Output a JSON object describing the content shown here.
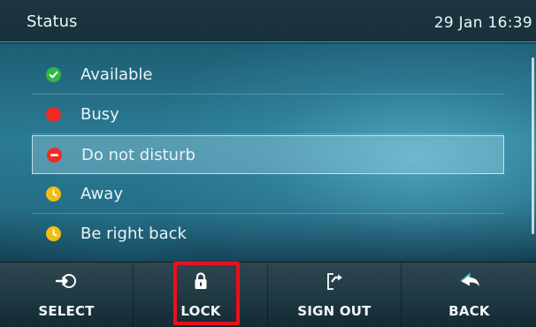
{
  "header": {
    "title": "Status",
    "clock": "29 Jan 16:39"
  },
  "statuses": [
    {
      "label": "Available",
      "icon": "check-circle-icon",
      "color": "#2fb845",
      "selected": false
    },
    {
      "label": "Busy",
      "icon": "red-circle-icon",
      "color": "#ee2b24",
      "selected": false
    },
    {
      "label": "Do not disturb",
      "icon": "minus-circle-icon",
      "color": "#ee2b24",
      "selected": true
    },
    {
      "label": "Away",
      "icon": "clock-circle-icon",
      "color": "#f2bd15",
      "selected": false
    },
    {
      "label": "Be right back",
      "icon": "clock-circle-icon",
      "color": "#f2bd15",
      "selected": false
    }
  ],
  "softkeys": [
    {
      "label": "SELECT",
      "icon": "select-arrow-icon"
    },
    {
      "label": "LOCK",
      "icon": "lock-icon"
    },
    {
      "label": "SIGN OUT",
      "icon": "sign-out-icon"
    },
    {
      "label": "BACK",
      "icon": "back-arrow-icon"
    }
  ],
  "colors": {
    "accent": "#38b5d0",
    "highlight": "#e8101e"
  }
}
